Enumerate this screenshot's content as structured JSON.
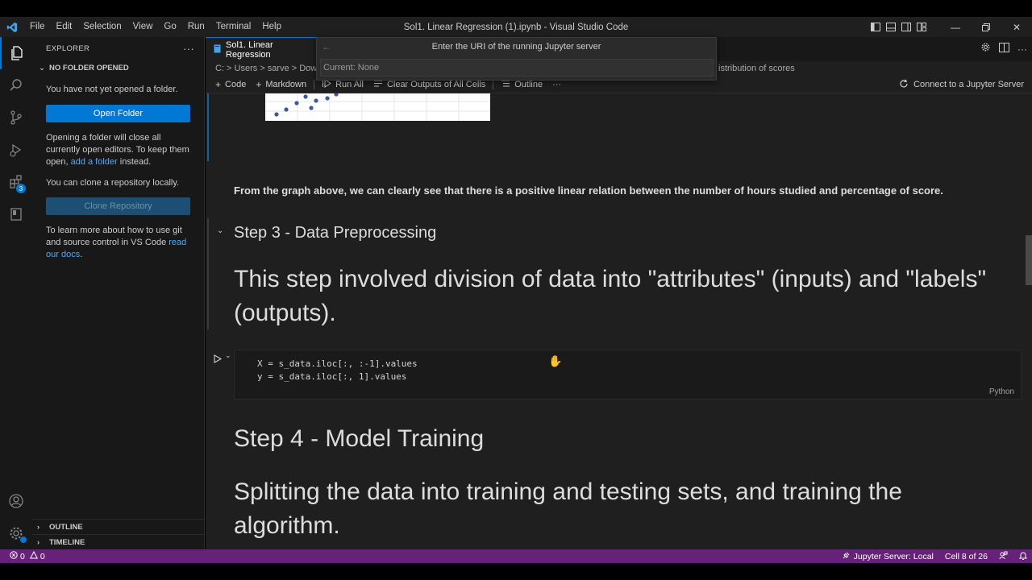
{
  "window": {
    "title": "Sol1. Linear Regression (1).ipynb - Visual Studio Code",
    "menu": [
      "File",
      "Edit",
      "Selection",
      "View",
      "Go",
      "Run",
      "Terminal",
      "Help"
    ]
  },
  "activity_bar": {
    "extensions_badge": "3"
  },
  "sidebar": {
    "header": "EXPLORER",
    "header_more": "···",
    "section": "NO FOLDER OPENED",
    "no_folder_text": "You have not yet opened a folder.",
    "open_folder_button": "Open Folder",
    "close_editors_text_1": "Opening a folder will close all currently open editors. To keep them open,",
    "add_folder_link": "add a folder",
    "close_editors_text_2": "instead.",
    "clone_text": "You can clone a repository locally.",
    "clone_button": "Clone Repository",
    "learn_text": "To learn more about how to use git and source control in VS Code",
    "read_docs_link": "read our docs",
    "learn_text_end": ".",
    "outline_label": "OUTLINE",
    "timeline_label": "TIMELINE"
  },
  "tab": {
    "label": "Sol1. Linear Regression"
  },
  "breadcrumb": {
    "prefix": "C: > Users > sarve > Dow",
    "suffix": "istribution of scores"
  },
  "nb_toolbar": {
    "code": "Code",
    "markdown": "Markdown",
    "run_all": "Run All",
    "clear_outputs": "Clear Outputs of All Cells",
    "outline": "Outline",
    "more": "···",
    "connect": "Connect to a Jupyter Server"
  },
  "quick_input": {
    "title": "Enter the URI of the running Jupyter server",
    "value": "Current: None"
  },
  "notebook": {
    "observation": "From the graph above, we can clearly see that there is a positive linear relation between the number of hours studied and percentage of score.",
    "step3_heading": "Step 3 - Data Preprocessing",
    "step3_text": "This step involved division of data into \"attributes\" (inputs) and \"labels\" (outputs).",
    "code_line_1": "X = s_data.iloc[:, :-1].values",
    "code_line_2": "y = s_data.iloc[:, 1].values",
    "code_language": "Python",
    "step4_heading": "Step 4 - Model Training",
    "step4_text": "Splitting the data into training and testing sets, and training the algorithm."
  },
  "status_bar": {
    "errors": "0",
    "warnings": "0",
    "jupyter_server": "Jupyter Server: Local",
    "cell_position": "Cell 8 of 26"
  },
  "colors": {
    "accent": "#0078d4",
    "status_bar": "#68217a"
  }
}
